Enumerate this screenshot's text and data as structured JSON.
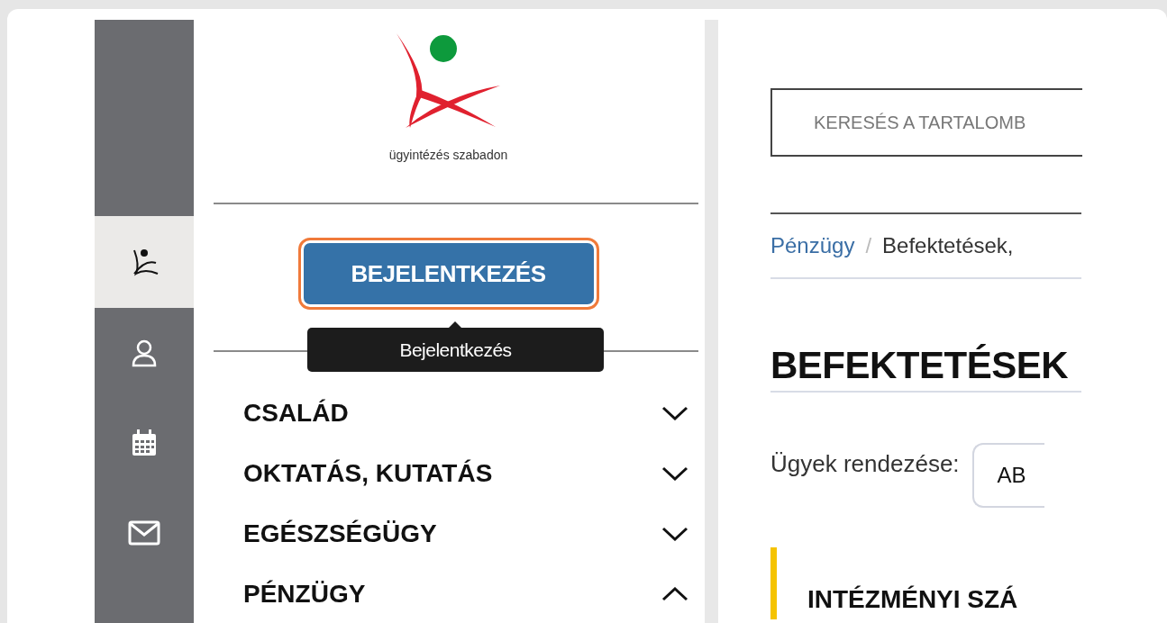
{
  "rail": {
    "items": [
      {
        "selected": true
      },
      {
        "selected": false
      },
      {
        "selected": false
      },
      {
        "selected": false
      }
    ]
  },
  "nav": {
    "tagline": "ügyintézés szabadon",
    "login_button": "BEJELENTKEZÉS",
    "tooltip": "Bejelentkezés",
    "items": [
      {
        "label": "CSALÁD",
        "expanded": false
      },
      {
        "label": "OKTATÁS, KUTATÁS",
        "expanded": false
      },
      {
        "label": "EGÉSZSÉGÜGY",
        "expanded": false
      },
      {
        "label": "PÉNZÜGY",
        "expanded": true
      }
    ]
  },
  "main": {
    "search": {
      "placeholder": "KERESÉS A TARTALOMB"
    },
    "breadcrumb": [
      {
        "label": "Pénzügy",
        "kind": "link"
      },
      {
        "label": "/",
        "kind": "separator"
      },
      {
        "label": "Befektetések,",
        "kind": "current"
      }
    ],
    "heading": "BEFEKTETÉSEK",
    "sort_label": "Ügyek rendezése:",
    "sort_value": "AB",
    "section_heading": "INTÉZMÉNYI SZÁ"
  }
}
